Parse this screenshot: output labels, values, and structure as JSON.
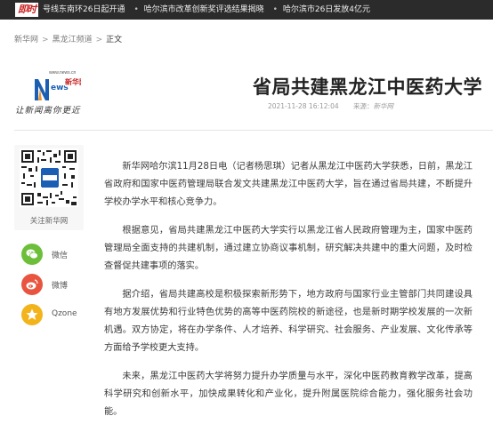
{
  "ticker": {
    "logo_text": "即时",
    "items": [
      "号线东南环26日起开通",
      "哈尔滨市改革创新奖评选结果揭晓",
      "哈尔滨市26日发放4亿元"
    ]
  },
  "breadcrumb": {
    "items": [
      "新华网",
      "黑龙江频道",
      "正文"
    ],
    "separator": ">"
  },
  "logo": {
    "url_text": "www.news.cn",
    "brand_cn": "新华网",
    "slogan": "让新闻离你更近"
  },
  "article": {
    "title": "省局共建黑龙江中医药大学",
    "datetime": "2021-11-28 16:12:04",
    "source_label": "来源：",
    "source": "新华网",
    "paragraphs": [
      "新华网哈尔滨11月28日电（记者杨思琪）记者从黑龙江中医药大学获悉，日前，黑龙江省政府和国家中医药管理局联合发文共建黑龙江中医药大学，旨在通过省局共建，不断提升学校办学水平和核心竞争力。",
      "根据意见，省局共建黑龙江中医药大学实行以黑龙江省人民政府管理为主，国家中医药管理局全面支持的共建机制，通过建立协商议事机制，研究解决共建中的重大问题，及时检查督促共建事项的落实。",
      "据介绍，省局共建高校是积极探索新形势下，地方政府与国家行业主管部门共同建设具有地方发展优势和行业特色优势的高等中医药院校的新途径，也是新时期学校发展的一次新机遇。双方协定，将在办学条件、人才培养、科学研究、社会服务、产业发展、文化传承等方面给予学校更大支持。",
      "未来，黑龙江中医药大学将努力提升办学质量与水平，深化中医药教育教学改革，提高科学研究和创新水平，加快成果转化和产业化，提升附属医院综合能力，强化服务社会功能。"
    ]
  },
  "share": {
    "qr_caption": "关注新华网",
    "items": [
      {
        "label": "微信",
        "icon": "wechat-icon",
        "color": "#6dbf3a"
      },
      {
        "label": "微博",
        "icon": "weibo-icon",
        "color": "#e8543f"
      },
      {
        "label": "Qzone",
        "icon": "qzone-icon",
        "color": "#f2b31b"
      }
    ]
  },
  "colors": {
    "ticker_bg": "#2b2b2b",
    "logo_red": "#c81e1e",
    "brand_blue": "#1a5fb4",
    "brand_orange": "#e88a1a"
  }
}
